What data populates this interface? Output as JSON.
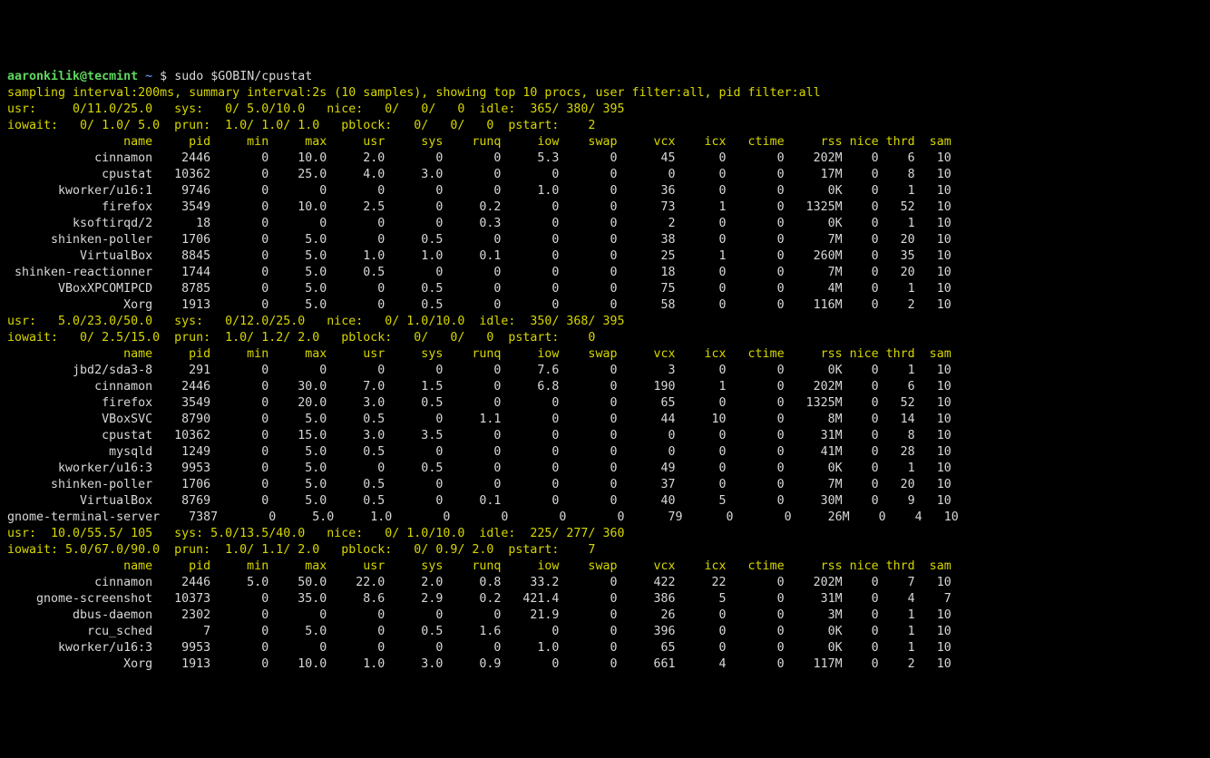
{
  "prompt": {
    "user": "aaronkilik@tecmint",
    "tilde": "~",
    "dollar": "$",
    "cmd": "sudo $GOBIN/cpustat"
  },
  "info": "sampling interval:200ms, summary interval:2s (10 samples), showing top 10 procs, user filter:all, pid filter:all",
  "widths": {
    "name": 20,
    "pid": 8,
    "min": 8,
    "max": 8,
    "usr": 8,
    "sys": 8,
    "runq": 8,
    "iow": 8,
    "swap": 8,
    "vcx": 8,
    "icx": 7,
    "ctime": 8,
    "rss": 8,
    "nice": 5,
    "thrd": 5,
    "sam": 5
  },
  "headers": [
    "name",
    "pid",
    "min",
    "max",
    "usr",
    "sys",
    "runq",
    "iow",
    "swap",
    "vcx",
    "icx",
    "ctime",
    "rss",
    "nice",
    "thrd",
    "sam"
  ],
  "blocks": [
    {
      "summary": {
        "usr": "0/11.0/25.0",
        "sys": "0/ 5.0/10.0",
        "nice": "0/   0/   0",
        "idle": "365/ 380/ 395",
        "iowait": "0/ 1.0/ 5.0",
        "prun": "1.0/ 1.0/ 1.0",
        "pblock": "0/   0/   0",
        "pstart": "2"
      },
      "rows": [
        {
          "name": "cinnamon",
          "pid": "2446",
          "min": "0",
          "max": "10.0",
          "usr": "2.0",
          "sys": "0",
          "runq": "0",
          "iow": "5.3",
          "swap": "0",
          "vcx": "45",
          "icx": "0",
          "ctime": "0",
          "rss": "202M",
          "nice": "0",
          "thrd": "6",
          "sam": "10"
        },
        {
          "name": "cpustat",
          "pid": "10362",
          "min": "0",
          "max": "25.0",
          "usr": "4.0",
          "sys": "3.0",
          "runq": "0",
          "iow": "0",
          "swap": "0",
          "vcx": "0",
          "icx": "0",
          "ctime": "0",
          "rss": "17M",
          "nice": "0",
          "thrd": "8",
          "sam": "10"
        },
        {
          "name": "kworker/u16:1",
          "pid": "9746",
          "min": "0",
          "max": "0",
          "usr": "0",
          "sys": "0",
          "runq": "0",
          "iow": "1.0",
          "swap": "0",
          "vcx": "36",
          "icx": "0",
          "ctime": "0",
          "rss": "0K",
          "nice": "0",
          "thrd": "1",
          "sam": "10"
        },
        {
          "name": "firefox",
          "pid": "3549",
          "min": "0",
          "max": "10.0",
          "usr": "2.5",
          "sys": "0",
          "runq": "0.2",
          "iow": "0",
          "swap": "0",
          "vcx": "73",
          "icx": "1",
          "ctime": "0",
          "rss": "1325M",
          "nice": "0",
          "thrd": "52",
          "sam": "10"
        },
        {
          "name": "ksoftirqd/2",
          "pid": "18",
          "min": "0",
          "max": "0",
          "usr": "0",
          "sys": "0",
          "runq": "0.3",
          "iow": "0",
          "swap": "0",
          "vcx": "2",
          "icx": "0",
          "ctime": "0",
          "rss": "0K",
          "nice": "0",
          "thrd": "1",
          "sam": "10"
        },
        {
          "name": "shinken-poller",
          "pid": "1706",
          "min": "0",
          "max": "5.0",
          "usr": "0",
          "sys": "0.5",
          "runq": "0",
          "iow": "0",
          "swap": "0",
          "vcx": "38",
          "icx": "0",
          "ctime": "0",
          "rss": "7M",
          "nice": "0",
          "thrd": "20",
          "sam": "10"
        },
        {
          "name": "VirtualBox",
          "pid": "8845",
          "min": "0",
          "max": "5.0",
          "usr": "1.0",
          "sys": "1.0",
          "runq": "0.1",
          "iow": "0",
          "swap": "0",
          "vcx": "25",
          "icx": "1",
          "ctime": "0",
          "rss": "260M",
          "nice": "0",
          "thrd": "35",
          "sam": "10"
        },
        {
          "name": "shinken-reactionner",
          "pid": "1744",
          "min": "0",
          "max": "5.0",
          "usr": "0.5",
          "sys": "0",
          "runq": "0",
          "iow": "0",
          "swap": "0",
          "vcx": "18",
          "icx": "0",
          "ctime": "0",
          "rss": "7M",
          "nice": "0",
          "thrd": "20",
          "sam": "10"
        },
        {
          "name": "VBoxXPCOMIPCD",
          "pid": "8785",
          "min": "0",
          "max": "5.0",
          "usr": "0",
          "sys": "0.5",
          "runq": "0",
          "iow": "0",
          "swap": "0",
          "vcx": "75",
          "icx": "0",
          "ctime": "0",
          "rss": "4M",
          "nice": "0",
          "thrd": "1",
          "sam": "10"
        },
        {
          "name": "Xorg",
          "pid": "1913",
          "min": "0",
          "max": "5.0",
          "usr": "0",
          "sys": "0.5",
          "runq": "0",
          "iow": "0",
          "swap": "0",
          "vcx": "58",
          "icx": "0",
          "ctime": "0",
          "rss": "116M",
          "nice": "0",
          "thrd": "2",
          "sam": "10"
        }
      ]
    },
    {
      "summary": {
        "usr": "5.0/23.0/50.0",
        "sys": "0/12.0/25.0",
        "nice": "0/ 1.0/10.0",
        "idle": "350/ 368/ 395",
        "iowait": "0/ 2.5/15.0",
        "prun": "1.0/ 1.2/ 2.0",
        "pblock": "0/   0/   0",
        "pstart": "0"
      },
      "rows": [
        {
          "name": "jbd2/sda3-8",
          "pid": "291",
          "min": "0",
          "max": "0",
          "usr": "0",
          "sys": "0",
          "runq": "0",
          "iow": "7.6",
          "swap": "0",
          "vcx": "3",
          "icx": "0",
          "ctime": "0",
          "rss": "0K",
          "nice": "0",
          "thrd": "1",
          "sam": "10"
        },
        {
          "name": "cinnamon",
          "pid": "2446",
          "min": "0",
          "max": "30.0",
          "usr": "7.0",
          "sys": "1.5",
          "runq": "0",
          "iow": "6.8",
          "swap": "0",
          "vcx": "190",
          "icx": "1",
          "ctime": "0",
          "rss": "202M",
          "nice": "0",
          "thrd": "6",
          "sam": "10"
        },
        {
          "name": "firefox",
          "pid": "3549",
          "min": "0",
          "max": "20.0",
          "usr": "3.0",
          "sys": "0.5",
          "runq": "0",
          "iow": "0",
          "swap": "0",
          "vcx": "65",
          "icx": "0",
          "ctime": "0",
          "rss": "1325M",
          "nice": "0",
          "thrd": "52",
          "sam": "10"
        },
        {
          "name": "VBoxSVC",
          "pid": "8790",
          "min": "0",
          "max": "5.0",
          "usr": "0.5",
          "sys": "0",
          "runq": "1.1",
          "iow": "0",
          "swap": "0",
          "vcx": "44",
          "icx": "10",
          "ctime": "0",
          "rss": "8M",
          "nice": "0",
          "thrd": "14",
          "sam": "10"
        },
        {
          "name": "cpustat",
          "pid": "10362",
          "min": "0",
          "max": "15.0",
          "usr": "3.0",
          "sys": "3.5",
          "runq": "0",
          "iow": "0",
          "swap": "0",
          "vcx": "0",
          "icx": "0",
          "ctime": "0",
          "rss": "31M",
          "nice": "0",
          "thrd": "8",
          "sam": "10"
        },
        {
          "name": "mysqld",
          "pid": "1249",
          "min": "0",
          "max": "5.0",
          "usr": "0.5",
          "sys": "0",
          "runq": "0",
          "iow": "0",
          "swap": "0",
          "vcx": "0",
          "icx": "0",
          "ctime": "0",
          "rss": "41M",
          "nice": "0",
          "thrd": "28",
          "sam": "10"
        },
        {
          "name": "kworker/u16:3",
          "pid": "9953",
          "min": "0",
          "max": "5.0",
          "usr": "0",
          "sys": "0.5",
          "runq": "0",
          "iow": "0",
          "swap": "0",
          "vcx": "49",
          "icx": "0",
          "ctime": "0",
          "rss": "0K",
          "nice": "0",
          "thrd": "1",
          "sam": "10"
        },
        {
          "name": "shinken-poller",
          "pid": "1706",
          "min": "0",
          "max": "5.0",
          "usr": "0.5",
          "sys": "0",
          "runq": "0",
          "iow": "0",
          "swap": "0",
          "vcx": "37",
          "icx": "0",
          "ctime": "0",
          "rss": "7M",
          "nice": "0",
          "thrd": "20",
          "sam": "10"
        },
        {
          "name": "VirtualBox",
          "pid": "8769",
          "min": "0",
          "max": "5.0",
          "usr": "0.5",
          "sys": "0",
          "runq": "0.1",
          "iow": "0",
          "swap": "0",
          "vcx": "40",
          "icx": "5",
          "ctime": "0",
          "rss": "30M",
          "nice": "0",
          "thrd": "9",
          "sam": "10"
        },
        {
          "name": "gnome-terminal-server",
          "pid": "7387",
          "min": "0",
          "max": "5.0",
          "usr": "1.0",
          "sys": "0",
          "runq": "0",
          "iow": "0",
          "swap": "0",
          "vcx": "79",
          "icx": "0",
          "ctime": "0",
          "rss": "26M",
          "nice": "0",
          "thrd": "4",
          "sam": "10"
        }
      ]
    },
    {
      "summary": {
        "usr": "10.0/55.5/ 105",
        "sys": "5.0/13.5/40.0",
        "nice": "0/ 1.0/10.0",
        "idle": "225/ 277/ 360",
        "iowait": "5.0/67.0/90.0",
        "prun": "1.0/ 1.1/ 2.0",
        "pblock": "0/ 0.9/ 2.0",
        "pstart": "7"
      },
      "rows": [
        {
          "name": "cinnamon",
          "pid": "2446",
          "min": "5.0",
          "max": "50.0",
          "usr": "22.0",
          "sys": "2.0",
          "runq": "0.8",
          "iow": "33.2",
          "swap": "0",
          "vcx": "422",
          "icx": "22",
          "ctime": "0",
          "rss": "202M",
          "nice": "0",
          "thrd": "7",
          "sam": "10"
        },
        {
          "name": "gnome-screenshot",
          "pid": "10373",
          "min": "0",
          "max": "35.0",
          "usr": "8.6",
          "sys": "2.9",
          "runq": "0.2",
          "iow": "421.4",
          "swap": "0",
          "vcx": "386",
          "icx": "5",
          "ctime": "0",
          "rss": "31M",
          "nice": "0",
          "thrd": "4",
          "sam": "7"
        },
        {
          "name": "dbus-daemon",
          "pid": "2302",
          "min": "0",
          "max": "0",
          "usr": "0",
          "sys": "0",
          "runq": "0",
          "iow": "21.9",
          "swap": "0",
          "vcx": "26",
          "icx": "0",
          "ctime": "0",
          "rss": "3M",
          "nice": "0",
          "thrd": "1",
          "sam": "10"
        },
        {
          "name": "rcu_sched",
          "pid": "7",
          "min": "0",
          "max": "5.0",
          "usr": "0",
          "sys": "0.5",
          "runq": "1.6",
          "iow": "0",
          "swap": "0",
          "vcx": "396",
          "icx": "0",
          "ctime": "0",
          "rss": "0K",
          "nice": "0",
          "thrd": "1",
          "sam": "10"
        },
        {
          "name": "kworker/u16:3",
          "pid": "9953",
          "min": "0",
          "max": "0",
          "usr": "0",
          "sys": "0",
          "runq": "0",
          "iow": "1.0",
          "swap": "0",
          "vcx": "65",
          "icx": "0",
          "ctime": "0",
          "rss": "0K",
          "nice": "0",
          "thrd": "1",
          "sam": "10"
        },
        {
          "name": "Xorg",
          "pid": "1913",
          "min": "0",
          "max": "10.0",
          "usr": "1.0",
          "sys": "3.0",
          "runq": "0.9",
          "iow": "0",
          "swap": "0",
          "vcx": "661",
          "icx": "4",
          "ctime": "0",
          "rss": "117M",
          "nice": "0",
          "thrd": "2",
          "sam": "10"
        }
      ]
    }
  ]
}
